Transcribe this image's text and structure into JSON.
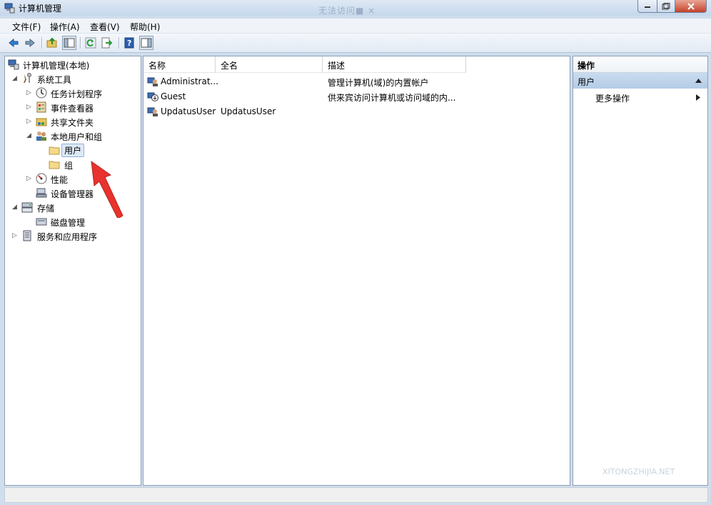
{
  "window": {
    "title": "计算机管理",
    "ghost_title": "无法访问■  ×"
  },
  "menu": [
    "文件(F)",
    "操作(A)",
    "查看(V)",
    "帮助(H)"
  ],
  "toolbar": {
    "buttons": [
      "back-icon",
      "forward-icon",
      "up-folder-icon",
      "show-hide-tree-icon",
      "refresh-icon",
      "export-list-icon",
      "help-icon",
      "show-hide-action-icon"
    ]
  },
  "tree": {
    "items": [
      {
        "label": "计算机管理(本地)",
        "icon": "computer-management-icon"
      },
      {
        "label": "系统工具",
        "icon": "system-tools-icon"
      },
      {
        "label": "任务计划程序",
        "icon": "clock-icon"
      },
      {
        "label": "事件查看器",
        "icon": "event-viewer-icon"
      },
      {
        "label": "共享文件夹",
        "icon": "shared-folder-icon"
      },
      {
        "label": "本地用户和组",
        "icon": "users-groups-icon"
      },
      {
        "label": "用户",
        "icon": "folder-icon"
      },
      {
        "label": "组",
        "icon": "folder-icon"
      },
      {
        "label": "性能",
        "icon": "performance-icon"
      },
      {
        "label": "设备管理器",
        "icon": "device-manager-icon"
      },
      {
        "label": "存储",
        "icon": "storage-icon"
      },
      {
        "label": "磁盘管理",
        "icon": "disk-icon"
      },
      {
        "label": "服务和应用程序",
        "icon": "services-icon"
      }
    ]
  },
  "list": {
    "columns": [
      "名称",
      "全名",
      "描述"
    ],
    "rows": [
      {
        "name": "Administrat...",
        "fullname": "",
        "description": "管理计算机(域)的内置帐户",
        "icon": "user-icon"
      },
      {
        "name": "Guest",
        "fullname": "",
        "description": "供来宾访问计算机或访问域的内...",
        "icon": "user-disabled-icon"
      },
      {
        "name": "UpdatusUser",
        "fullname": "UpdatusUser",
        "description": "",
        "icon": "user-icon"
      }
    ]
  },
  "actions": {
    "header": "操作",
    "section": "用户",
    "more": "更多操作"
  },
  "watermark": "XITONGZHIJIA.NET",
  "colors": {
    "selection_bg": "#dde9f7",
    "action_section": "#b4cce6",
    "arrow": "#e8322d"
  }
}
